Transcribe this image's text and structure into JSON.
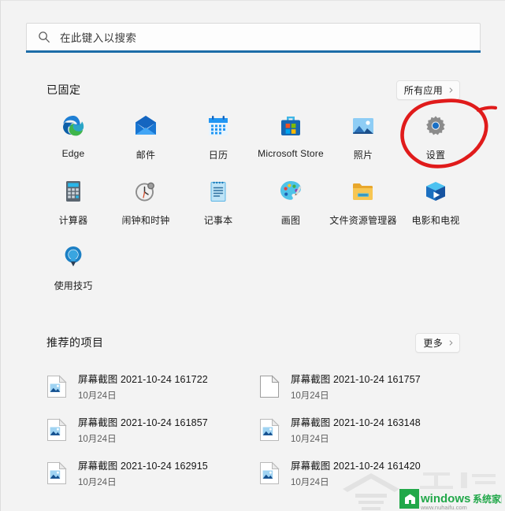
{
  "search": {
    "placeholder": "在此键入以搜索",
    "icon": "search-icon",
    "accent_color": "#1c6ca8"
  },
  "pinned": {
    "title": "已固定",
    "all_apps_label": "所有应用",
    "all_apps_icon": "chevron-right-icon",
    "apps": [
      {
        "label": "Edge",
        "icon": "edge-icon"
      },
      {
        "label": "邮件",
        "icon": "mail-icon"
      },
      {
        "label": "日历",
        "icon": "calendar-icon"
      },
      {
        "label": "Microsoft Store",
        "icon": "microsoft-store-icon"
      },
      {
        "label": "照片",
        "icon": "photos-icon"
      },
      {
        "label": "设置",
        "icon": "settings-gear-icon"
      },
      {
        "label": "计算器",
        "icon": "calculator-icon"
      },
      {
        "label": "闹钟和时钟",
        "icon": "alarms-clock-icon"
      },
      {
        "label": "记事本",
        "icon": "notepad-icon"
      },
      {
        "label": "画图",
        "icon": "paint-icon"
      },
      {
        "label": "文件资源管理器",
        "icon": "file-explorer-icon"
      },
      {
        "label": "电影和电视",
        "icon": "movies-tv-icon"
      },
      {
        "label": "使用技巧",
        "icon": "tips-bulb-icon"
      }
    ]
  },
  "recommended": {
    "title": "推荐的项目",
    "more_label": "更多",
    "more_icon": "chevron-right-icon",
    "items": [
      {
        "title": "屏幕截图 2021-10-24 161722",
        "subtitle": "10月24日",
        "icon": "image-file-icon"
      },
      {
        "title": "屏幕截图 2021-10-24 161757",
        "subtitle": "10月24日",
        "icon": "blank-file-icon"
      },
      {
        "title": "屏幕截图 2021-10-24 161857",
        "subtitle": "10月24日",
        "icon": "image-file-icon"
      },
      {
        "title": "屏幕截图 2021-10-24 163148",
        "subtitle": "10月24日",
        "icon": "image-file-icon"
      },
      {
        "title": "屏幕截图 2021-10-24 162915",
        "subtitle": "10月24日",
        "icon": "image-file-icon"
      },
      {
        "title": "屏幕截图 2021-10-24 161420",
        "subtitle": "10月24日",
        "icon": "image-file-icon"
      }
    ]
  },
  "annotation": {
    "shape": "red-circle-highlight",
    "target": "设置",
    "color": "#e01b1b"
  },
  "watermark": {
    "brand": "windows系统家园",
    "url": "www.nuhaifu.com",
    "brand_color": "#22a84a"
  }
}
